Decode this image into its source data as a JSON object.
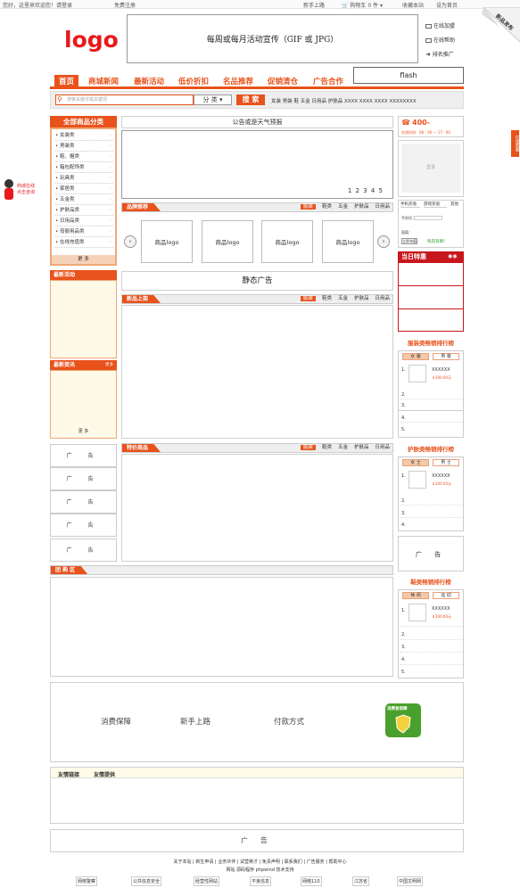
{
  "topbar": {
    "welcome": "您好，这里来欢迎您！请登录",
    "register": "免费注册",
    "guide": "新手上路",
    "cart": "购物车 0 件 ▾",
    "favorite": "收藏本站",
    "homepage": "设为首页"
  },
  "corner_badge": "新品发布",
  "header": {
    "logo": "logo",
    "banner_text": "每周或每月活动宣传（GIF 或 JPG）",
    "flash": "flash",
    "services": [
      "在线加盟",
      "在线帮助",
      "排名推广"
    ]
  },
  "nav": {
    "items": [
      "首页",
      "商城新闻",
      "最新活动",
      "低价折扣",
      "名品推荐",
      "促销清仓",
      "广告合作"
    ]
  },
  "search": {
    "placeholder": "搜索关键字或关键词",
    "category": "分 类 ▾",
    "button": "搜 索",
    "hot_words": "女装  男装  鞋  五金  日用品  护肤品  XXXX  XXXX  XXXX  XXXXXXXX"
  },
  "categories": {
    "title": "全部商品分类",
    "items": [
      "• 女装类",
      "• 男装类",
      "• 鞋、帽类",
      "• 箱包配饰类",
      "• 玩具类",
      "• 家居类",
      "• 五金类",
      "• 护肤品类",
      "• 日用品类",
      "• 母婴用品类",
      "• 在线充值类"
    ],
    "more": "更  多"
  },
  "notice": {
    "title": "公告或是天气预报",
    "pages": "1  2  3  4  5"
  },
  "brand_section": {
    "title": "品牌推荐",
    "tabs": [
      "服装",
      "鞋类",
      "五金",
      "护肤品",
      "日用品"
    ],
    "brands": [
      "商品logo",
      "商品logo",
      "商品logo",
      "商品logo"
    ],
    "prev": "‹",
    "next": "›"
  },
  "static_ad": "静态广告",
  "new_section": {
    "title": "新品上架",
    "tabs": [
      "服装",
      "鞋类",
      "五金",
      "护肤品",
      "日用品"
    ]
  },
  "special_section": {
    "title": "特价商品",
    "tabs": [
      "服装",
      "鞋类",
      "五金",
      "护肤品",
      "日用品"
    ]
  },
  "group_section": {
    "title": "团 购 区"
  },
  "left_panels": {
    "activity": "最新活动",
    "news": "最新资讯",
    "news_more": "更多",
    "more_link": "更  多"
  },
  "ads": {
    "label": "广  告"
  },
  "right": {
    "phone": "400-",
    "hours": "在线时间：08：00 — 17：00",
    "login_placeholder": "登录",
    "recharge_tabs": [
      "手机充值",
      "游戏充值",
      "其他"
    ],
    "recharge_number": "手机号：",
    "recharge_amount": "面值：",
    "recharge_button": "立即充值",
    "recharge_link": "快充有赠！",
    "daily_title": "当日特惠",
    "clothing_rank": "服装类畅销排行榜",
    "clothing_tabs": [
      "女 装",
      "男 装"
    ],
    "skincare_rank": "护肤类畅销排行榜",
    "skincare_tabs": [
      "女 士",
      "男 士"
    ],
    "shoes_rank": "鞋类畅销排行榜",
    "shoes_tabs": [
      "休 闲",
      "运 动"
    ],
    "item_name": "XXXXXX",
    "item_price": "￥200.00元",
    "numbers": [
      "1.",
      "2.",
      "3.",
      "4.",
      "5."
    ]
  },
  "left_float": "商城在线\n点击咨询",
  "right_float": "在线客服",
  "guarantee": {
    "items": [
      "消费保障",
      "新手上路",
      "付款方式"
    ],
    "badge": "消费者保障"
  },
  "links": {
    "tabs": [
      "友情链接",
      "友情提供"
    ]
  },
  "bottom_ad": "广  告",
  "footer": {
    "links": "关于本站 | 新生申请 | 业务伙伴 | 试营英才 | 免责声明 | 联系我们 | 广告服务 | 帮助中心",
    "tech": "网站 源码程序 phpwind 技术支持",
    "badges": [
      "网络警察",
      "公共信息安全",
      "经营性网站",
      "不良信息",
      "网络110",
      "江苏省",
      "中国文明网"
    ]
  },
  "colors": {
    "accent": "#e8521b",
    "logo": "#e8191b",
    "panel_bg": "#fff9e8"
  }
}
